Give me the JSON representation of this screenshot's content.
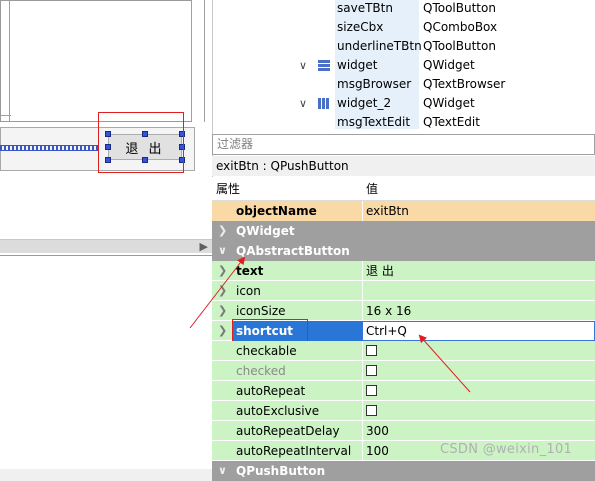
{
  "canvas": {
    "exit_button_label": "退 出"
  },
  "object_tree": {
    "rows": [
      {
        "name": "saveTBtn",
        "class": "QToolButton",
        "expandable": false,
        "icon": null
      },
      {
        "name": "sizeCbx",
        "class": "QComboBox",
        "expandable": false,
        "icon": null
      },
      {
        "name": "underlineTBtn",
        "class": "QToolButton",
        "expandable": false,
        "icon": null
      },
      {
        "name": "widget",
        "class": "QWidget",
        "expandable": true,
        "icon": "vertical-layout-icon"
      },
      {
        "name": "msgBrowser",
        "class": "QTextBrowser",
        "expandable": false,
        "icon": null
      },
      {
        "name": "widget_2",
        "class": "QWidget",
        "expandable": true,
        "icon": "horizontal-layout-icon"
      },
      {
        "name": "msgTextEdit",
        "class": "QTextEdit",
        "expandable": false,
        "icon": null
      }
    ]
  },
  "property_editor": {
    "filter_placeholder": "过滤器",
    "object_label": "exitBtn : QPushButton",
    "header_property": "属性",
    "header_value": "值",
    "rows": [
      {
        "type": "prop",
        "style": "obj",
        "name": "objectName",
        "value": "exitBtn",
        "bold": true
      },
      {
        "type": "group",
        "name": "QWidget",
        "expanded": false
      },
      {
        "type": "group",
        "name": "QAbstractButton",
        "expanded": true
      },
      {
        "type": "prop",
        "style": "green",
        "name": "text",
        "value": "退 出",
        "bold": true,
        "expandable": true
      },
      {
        "type": "prop",
        "style": "green",
        "name": "icon",
        "value": "",
        "expandable": true
      },
      {
        "type": "prop",
        "style": "green",
        "name": "iconSize",
        "value": "16 x 16",
        "expandable": true
      },
      {
        "type": "prop",
        "style": "green",
        "name": "shortcut",
        "value": "Ctrl+Q",
        "expandable": true,
        "selected": true
      },
      {
        "type": "prop",
        "style": "green",
        "name": "checkable",
        "checkbox": true
      },
      {
        "type": "prop",
        "style": "green",
        "name": "checked",
        "checkbox": true,
        "disabled": true
      },
      {
        "type": "prop",
        "style": "green",
        "name": "autoRepeat",
        "checkbox": true
      },
      {
        "type": "prop",
        "style": "green",
        "name": "autoExclusive",
        "checkbox": true
      },
      {
        "type": "prop",
        "style": "green",
        "name": "autoRepeatDelay",
        "value": "300"
      },
      {
        "type": "prop",
        "style": "green",
        "name": "autoRepeatInterval",
        "value": "100"
      },
      {
        "type": "group",
        "name": "QPushButton",
        "expanded": true
      }
    ]
  },
  "watermark": "CSDN @weixin_101",
  "colors": {
    "object_group_bg": "#f9d9a6",
    "abstract_button_bg": "#cbf3c4",
    "group_header_bg": "#9f9f9f",
    "selection_blue": "#2a76d6",
    "annotation_red": "#e02020"
  }
}
